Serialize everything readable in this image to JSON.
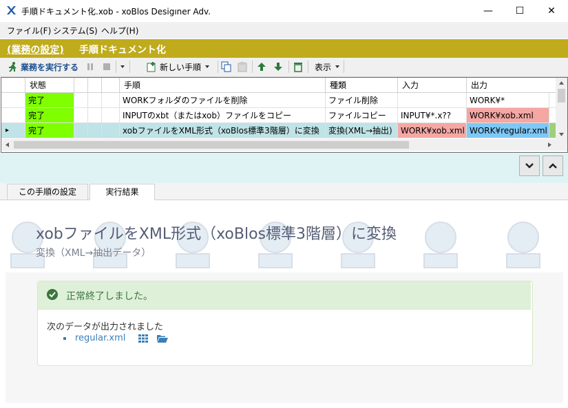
{
  "window": {
    "title": "手順ドキュメント化.xob - xoBlos Desigıner Adv.",
    "buttons": {
      "minimize": "—",
      "maximize": "☐",
      "close": "✕"
    }
  },
  "menu": [
    "ファイル(F)",
    "システム(S)",
    "ヘルプ(H)"
  ],
  "header": {
    "task_link": "(業務の設定)",
    "page_title": "手順ドキュメント化",
    "color": "#bfab1c"
  },
  "toolbar": {
    "run_label": "業務を実行する",
    "new_step_label": "新しい手順",
    "view_label": "表示"
  },
  "grid": {
    "columns": [
      "状態",
      "手順",
      "種類",
      "入力",
      "出力"
    ],
    "rows": [
      {
        "status": "完了",
        "step": "WORKフォルダのファイルを削除",
        "type": "ファイル削除",
        "input": "",
        "output": "WORK¥*",
        "selected": false
      },
      {
        "status": "完了",
        "step": "INPUTのxbt（またはxob）ファイルをコピー",
        "type": "ファイルコピー",
        "input": "INPUT¥*.x??",
        "output": "WORK¥xob.xml",
        "selected": false
      },
      {
        "status": "完了",
        "step": "xobファイルをXML形式（xoBlos標準3階層）に変換",
        "type": "変換(XML→抽出)",
        "input": "WORK¥xob.xml",
        "output": "WORK¥regular.xml",
        "selected": true
      }
    ],
    "colors": {
      "status_done": "#7fff00",
      "red_cell": "#f4a7a3",
      "blue_cell": "#7ec8f5",
      "selected_row": "#bfe3e6"
    }
  },
  "tabs": [
    "この手順の設定",
    "実行結果"
  ],
  "result": {
    "step_title": "xobファイルをXML形式（xoBlos標準3階層）に変換",
    "step_subtitle": "変換（XML→抽出データ）",
    "status_text": "正常終了しました。",
    "output_message": "次のデータが出力されました",
    "output_files": [
      "regular.xml"
    ]
  }
}
